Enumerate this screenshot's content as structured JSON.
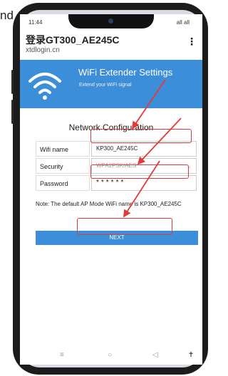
{
  "cropped_text": "nd",
  "status_bar": {
    "time": "11:44",
    "signal": "all all"
  },
  "browser": {
    "page_title": "登录GT300_AE245C",
    "url": "xtdlogin.cn",
    "menu_icon": "kebab-menu-icon"
  },
  "banner": {
    "title": "WiFi Extender Settings",
    "subtitle": "Extend your WiFi signal",
    "icon": "wifi-icon"
  },
  "section_title": "Network Configuration",
  "form": {
    "wifi_name_label": "Wifi name",
    "wifi_name_value": "KP300_AE245C",
    "security_label": "Security",
    "security_value": "WPA2PSK/AES",
    "password_label": "Password",
    "password_value": "******"
  },
  "note": "Note: The default AP Mode WiFi name is KP300_AE245C",
  "next_label": "NEXT",
  "nav": {
    "menu": "≡",
    "home": "○",
    "back": "◁",
    "accessibility": "✝"
  },
  "colors": {
    "accent": "#3d8ed9",
    "highlight": "#e23a3a"
  }
}
